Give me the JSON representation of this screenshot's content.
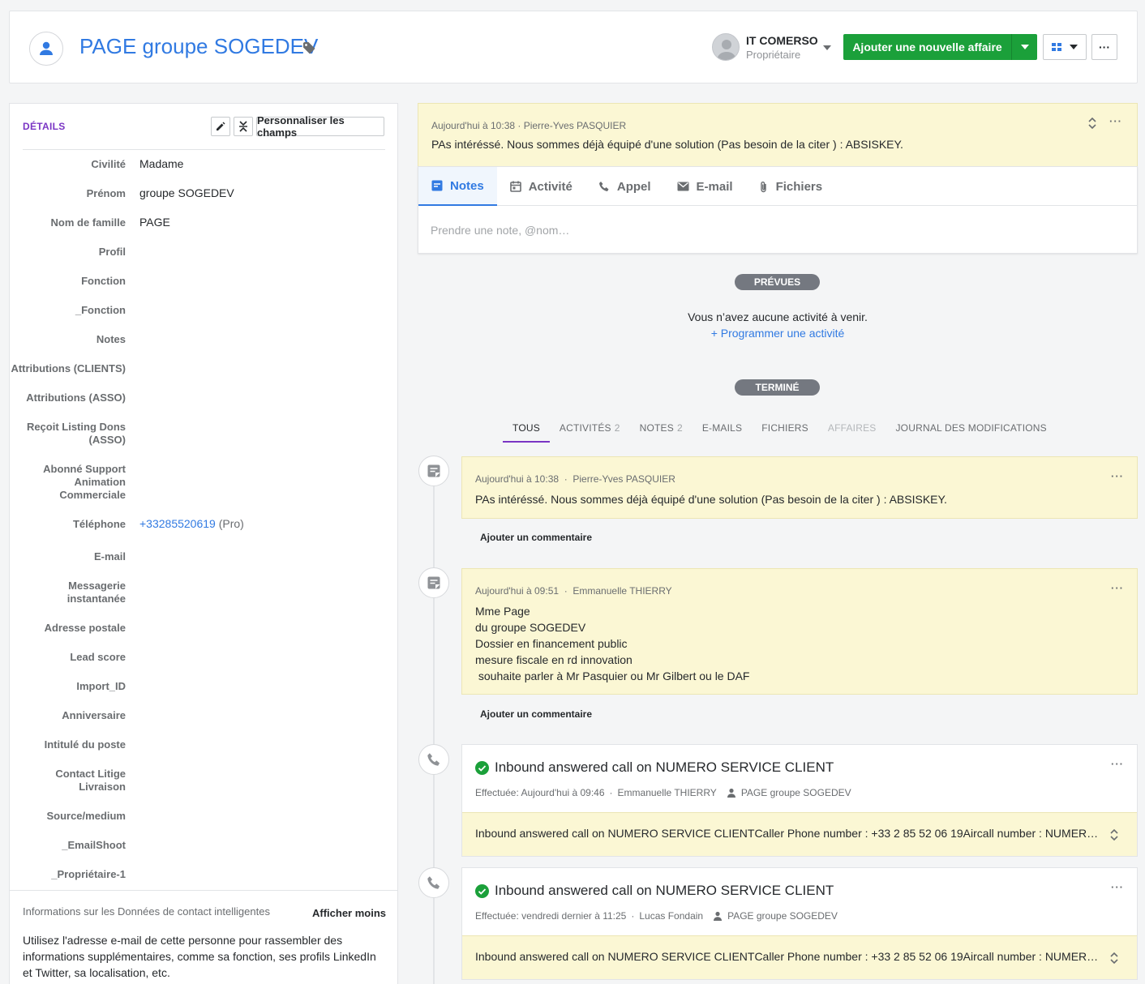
{
  "header": {
    "title": "PAGE groupe SOGEDEV",
    "owner_name": "IT COMERSO",
    "owner_role": "Propriétaire",
    "add_deal_label": "Ajouter une nouvelle affaire",
    "more_label": "···"
  },
  "details": {
    "title": "DÉTAILS",
    "customize_label": "Personnaliser les champs",
    "fields": [
      {
        "label": "Civilité",
        "value": "Madame"
      },
      {
        "label": "Prénom",
        "value": "groupe SOGEDEV"
      },
      {
        "label": "Nom de famille",
        "value": "PAGE"
      },
      {
        "label": "Profil",
        "value": ""
      },
      {
        "label": "Fonction",
        "value": ""
      },
      {
        "label": "_Fonction",
        "value": ""
      },
      {
        "label": "Notes",
        "value": ""
      },
      {
        "label": "Attributions (CLIENTS)",
        "value": ""
      },
      {
        "label": "Attributions (ASSO)",
        "value": ""
      },
      {
        "label": "Reçoit Listing Dons (ASSO)",
        "value": ""
      },
      {
        "label": "Abonné Support Animation Commerciale",
        "value": ""
      },
      {
        "label": "Téléphone",
        "value": "+33285520619",
        "suffix": " (Pro)"
      },
      {
        "label": "E-mail",
        "value": ""
      },
      {
        "label": "Messagerie instantanée",
        "value": ""
      },
      {
        "label": "Adresse postale",
        "value": ""
      },
      {
        "label": "Lead score",
        "value": ""
      },
      {
        "label": "Import_ID",
        "value": ""
      },
      {
        "label": "Anniversaire",
        "value": ""
      },
      {
        "label": "Intitulé du poste",
        "value": ""
      },
      {
        "label": "Contact Litige Livraison",
        "value": ""
      },
      {
        "label": "Source/medium",
        "value": ""
      },
      {
        "label": "_EmailShoot",
        "value": ""
      },
      {
        "label": "_Propriétaire-1",
        "value": ""
      }
    ],
    "smart_title": "Informations sur les Données de contact intelligentes",
    "smart_toggle": "Afficher moins",
    "smart_body": "Utilisez l'adresse e-mail de cette personne pour rassembler des informations supplémentaires, comme sa fonction, ses profils LinkedIn et Twitter, sa localisation, etc."
  },
  "pinned": {
    "meta": "Aujourd'hui à 10:38 · Pierre-Yves PASQUIER",
    "text": "PAs intéréssé. Nous sommes déjà équipé d'une solution (Pas besoin de la citer ) : ABSISKEY."
  },
  "composer": {
    "tabs": [
      "Notes",
      "Activité",
      "Appel",
      "E-mail",
      "Fichiers"
    ],
    "placeholder": "Prendre une note, @nom…"
  },
  "planned": {
    "pill": "PRÉVUES",
    "empty_text": "Vous n’avez aucune activité à venir.",
    "schedule_link": "+ Programmer une activité"
  },
  "done": {
    "pill": "TERMINÉ",
    "filters": [
      {
        "label": "TOUS",
        "count": ""
      },
      {
        "label": "ACTIVITÉS",
        "count": "2"
      },
      {
        "label": "NOTES",
        "count": "2"
      },
      {
        "label": "E-MAILS",
        "count": ""
      },
      {
        "label": "FICHIERS",
        "count": ""
      },
      {
        "label": "AFFAIRES",
        "count": ""
      },
      {
        "label": "JOURNAL DES MODIFICATIONS",
        "count": ""
      }
    ]
  },
  "timeline": {
    "comment_label": "Ajouter un commentaire",
    "note1": {
      "date": "Aujourd'hui à 10:38",
      "author": "Pierre-Yves PASQUIER",
      "text": "PAs intéréssé. Nous sommes déjà équipé d'une solution (Pas besoin de la citer ) : ABSISKEY."
    },
    "note2": {
      "date": "Aujourd'hui à 09:51",
      "author": "Emmanuelle THIERRY",
      "text": "Mme Page\ndu groupe SOGEDEV\nDossier en financement public\nmesure fiscale en rd innovation\n souhaite parler à Mr Pasquier ou Mr Gilbert ou le DAF"
    },
    "call1": {
      "title": "Inbound answered call on NUMERO SERVICE CLIENT",
      "done": "Effectuée: Aujourd'hui à 09:46",
      "author": "Emmanuelle THIERRY",
      "contact": "PAGE groupe SOGEDEV",
      "desc": "Inbound answered call on NUMERO SERVICE CLIENTCaller Phone number : +33 2 85 52 06 19Aircall number : NUMERO SERVICE CLIENT"
    },
    "call2": {
      "title": "Inbound answered call on NUMERO SERVICE CLIENT",
      "done": "Effectuée: vendredi dernier à 11:25",
      "author": "Lucas Fondain",
      "contact": "PAGE groupe SOGEDEV",
      "desc": "Inbound answered call on NUMERO SERVICE CLIENTCaller Phone number : +33 2 85 52 06 19Aircall number : NUMERO SERVICE CLIENT"
    }
  },
  "colors": {
    "brand_green": "#1ba03a",
    "link_blue": "#317ae2",
    "accent_purple": "#7a35c4",
    "note_yellow": "#fbf7d4"
  }
}
